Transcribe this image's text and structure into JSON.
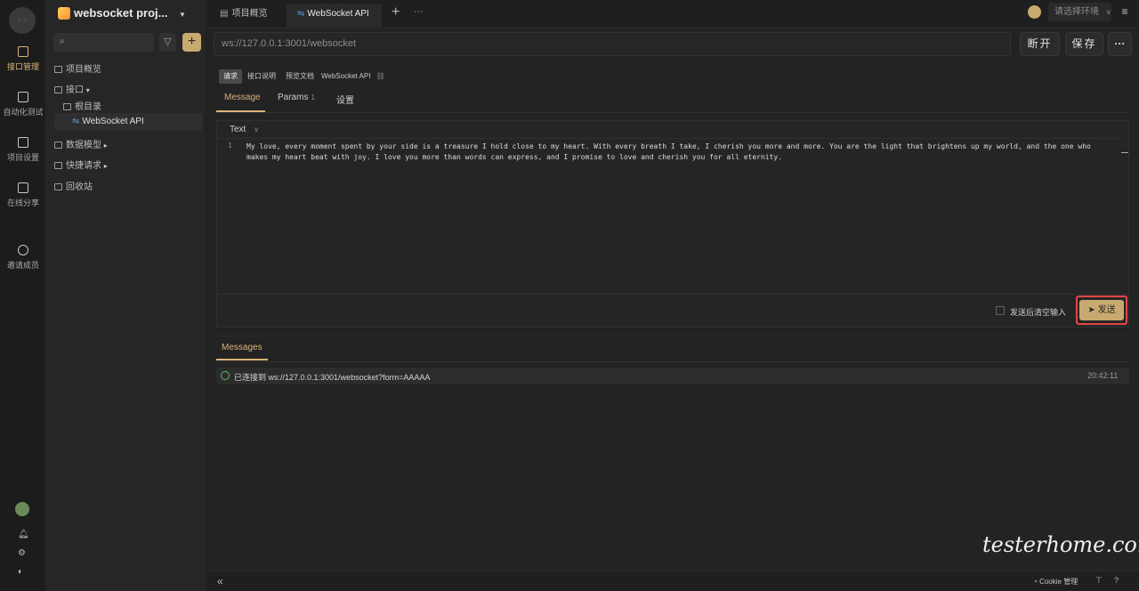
{
  "rail": {
    "items": [
      {
        "label": "接口管理",
        "icon": "api-icon",
        "active": true
      },
      {
        "label": "自动化测试",
        "icon": "automation-icon"
      },
      {
        "label": "项目设置",
        "icon": "settings-icon"
      },
      {
        "label": "在线分享",
        "icon": "share-icon"
      },
      {
        "label": "邀请成员",
        "icon": "invite-icon"
      }
    ]
  },
  "sidebar": {
    "project_name": "websocket proj...",
    "tree": {
      "overview": "项目概览",
      "api": "接口",
      "root": "根目录",
      "websocket_api": "WebSocket API",
      "data_models": "数据模型",
      "quick_requests": "快捷请求",
      "recycle": "回收站"
    }
  },
  "tabs": {
    "overview": "项目概览",
    "websocket": "WebSocket API",
    "env_placeholder": "请选择环境"
  },
  "url_bar": {
    "value": "ws://127.0.0.1:3001/websocket",
    "disconnect": "断开",
    "save": "保存",
    "more": "···"
  },
  "doc_tabs": {
    "request": "请求",
    "description": "接口说明",
    "preview": "预览文档",
    "name": "WebSocket API"
  },
  "sub_tabs": {
    "message": "Message",
    "params": "Params",
    "params_count": "1",
    "settings": "设置"
  },
  "editor": {
    "format": "Text",
    "line_number": "1",
    "content_line1": "My love, every moment spent by your side is a treasure I hold close to my heart. With every breath I take, I cherish you more and more. You are the light that brightens up my world, and the one who",
    "content_line2": "makes my heart beat with joy. I love you more than words can express, and I promise to love and cherish you for all eternity.",
    "clear_after_send": "发送后清空输入",
    "send": "发送"
  },
  "messages": {
    "tab": "Messages",
    "items": [
      {
        "text": "已连接到 ws://127.0.0.1:3001/websocket?form=AAAAA",
        "time": "20:42:11"
      }
    ]
  },
  "footer": {
    "collapse": "«",
    "cookie": "Cookie 管理",
    "watermark": "testerhome.com"
  },
  "colors": {
    "accent": "#c8a96f",
    "highlight": "#e34545",
    "success": "#5dbb63"
  }
}
